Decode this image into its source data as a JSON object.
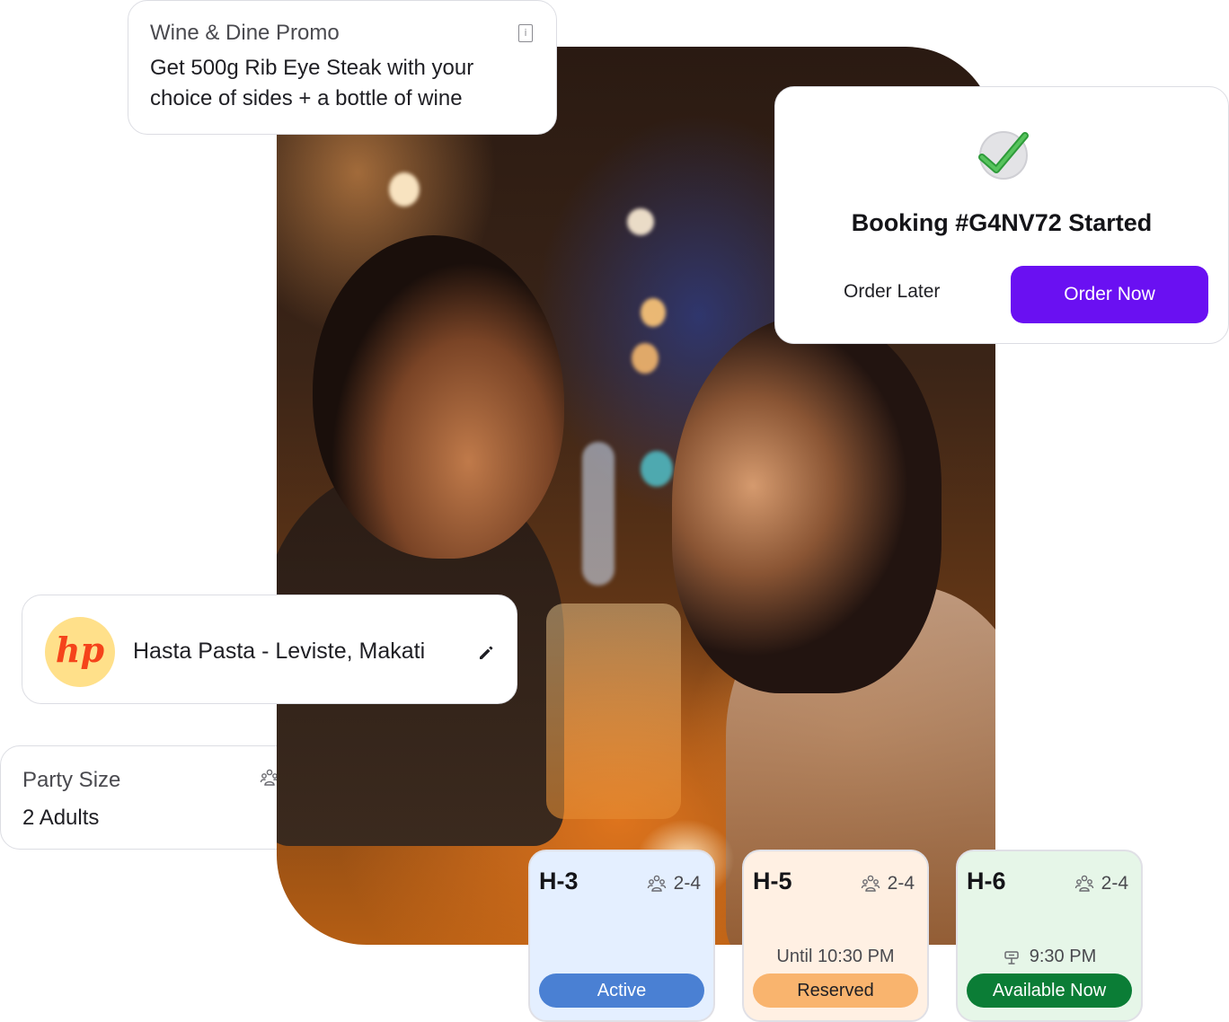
{
  "promo": {
    "title": "Wine & Dine Promo",
    "body": "Get 500g Rib Eye Steak with your choice of sides + a bottle of wine",
    "icon": "info-icon"
  },
  "booking": {
    "icon": "check-icon",
    "heading": "Booking #G4NV72 Started",
    "order_later": "Order Later",
    "order_now": "Order Now",
    "accent_color": "#6a10f2"
  },
  "restaurant": {
    "logo_text": "hp",
    "name": "Hasta Pasta - Leviste, Makati",
    "icon": "edit-icon"
  },
  "party": {
    "label": "Party Size",
    "value": "2 Adults",
    "icon": "people-icon"
  },
  "tables": [
    {
      "name": "H-3",
      "capacity": "2-4",
      "time": "",
      "status": "Active",
      "status_color": "#4a80d3"
    },
    {
      "name": "H-5",
      "capacity": "2-4",
      "time": "Until 10:30 PM",
      "status": "Reserved",
      "status_color": "#f9b46e"
    },
    {
      "name": "H-6",
      "capacity": "2-4",
      "time": "9:30 PM",
      "status": "Available Now",
      "status_color": "#0b7d36"
    }
  ]
}
